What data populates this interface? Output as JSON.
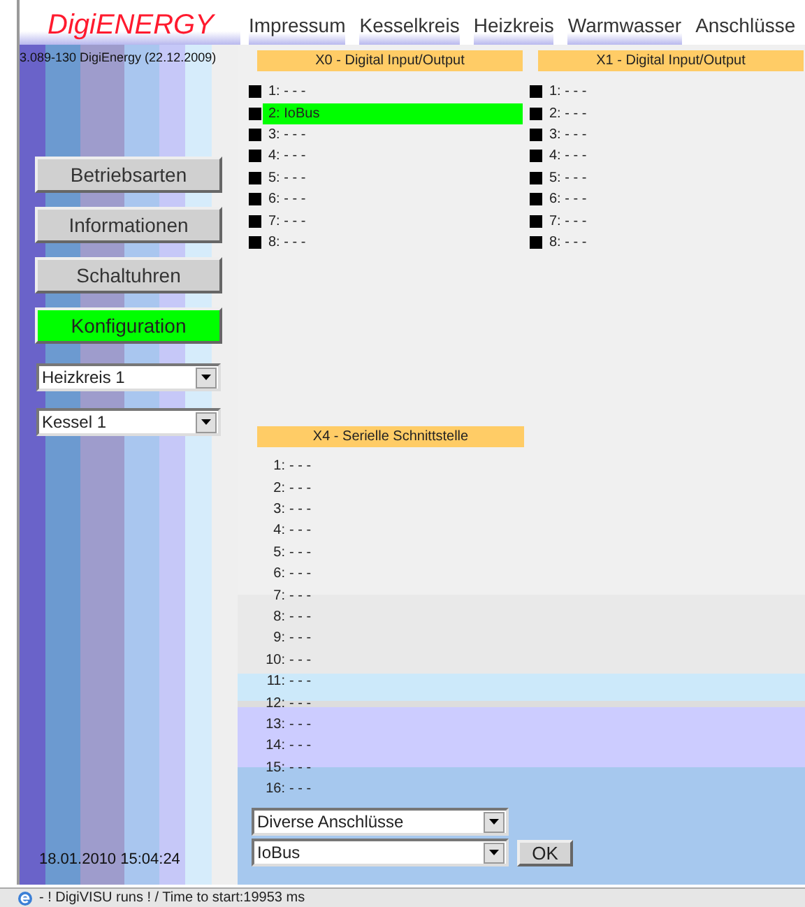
{
  "logo": "DigiENERGY",
  "nav": [
    {
      "label": "Impressum",
      "selected": false
    },
    {
      "label": "Kesselkreis",
      "selected": false
    },
    {
      "label": "Heizkreis",
      "selected": false
    },
    {
      "label": "Warmwasser",
      "selected": false
    },
    {
      "label": "Anschlüsse",
      "selected": true
    }
  ],
  "sidebar": {
    "version": "3.089-130 DigiEnergy (22.12.2009)",
    "buttons": [
      {
        "label": "Betriebsarten",
        "selected": false
      },
      {
        "label": "Informationen",
        "selected": false
      },
      {
        "label": "Schaltuhren",
        "selected": false
      },
      {
        "label": "Konfiguration",
        "selected": true
      }
    ],
    "selects": [
      "Heizkreis 1",
      "Kessel 1"
    ],
    "datetime": "18.01.2010 15:04:24"
  },
  "panels": [
    {
      "title": "X0 - Digital Input/Output",
      "rows": [
        {
          "label": "1: - - -",
          "selected": false
        },
        {
          "label": "2: IoBus",
          "selected": true
        },
        {
          "label": "3: - - -",
          "selected": false
        },
        {
          "label": "4: - - -",
          "selected": false
        },
        {
          "label": "5: - - -",
          "selected": false
        },
        {
          "label": "6: - - -",
          "selected": false
        },
        {
          "label": "7: - - -",
          "selected": false
        },
        {
          "label": "8: - - -",
          "selected": false
        }
      ]
    },
    {
      "title": "X1 - Digital Input/Output",
      "rows": [
        {
          "label": "1: - - -",
          "selected": false
        },
        {
          "label": "2: - - -",
          "selected": false
        },
        {
          "label": "3: - - -",
          "selected": false
        },
        {
          "label": "4: - - -",
          "selected": false
        },
        {
          "label": "5: - - -",
          "selected": false
        },
        {
          "label": "6: - - -",
          "selected": false
        },
        {
          "label": "7: - - -",
          "selected": false
        },
        {
          "label": "8: - - -",
          "selected": false
        }
      ]
    }
  ],
  "serial": {
    "title": "X4 - Serielle Schnittstelle",
    "rows": [
      {
        "number": "1:",
        "value": "- - -"
      },
      {
        "number": "2:",
        "value": "- - -"
      },
      {
        "number": "3:",
        "value": "- - -"
      },
      {
        "number": "4:",
        "value": "- - -"
      },
      {
        "number": "5:",
        "value": "- - -"
      },
      {
        "number": "6:",
        "value": "- - -"
      },
      {
        "number": "7:",
        "value": "- - -"
      },
      {
        "number": "8:",
        "value": "- - -"
      },
      {
        "number": "9:",
        "value": "- - -"
      },
      {
        "number": "10:",
        "value": "- - -"
      },
      {
        "number": "11:",
        "value": "- - -"
      },
      {
        "number": "12:",
        "value": "- - -"
      },
      {
        "number": "13:",
        "value": "- - -"
      },
      {
        "number": "14:",
        "value": "- - -"
      },
      {
        "number": "15:",
        "value": "- - -"
      },
      {
        "number": "16:",
        "value": "- - -"
      }
    ]
  },
  "form": {
    "selects": [
      "Diverse Anschlüsse",
      "IoBus"
    ],
    "button": "OK"
  },
  "status_bar": "- ! DigiVISU runs ! / Time to start:19953 ms"
}
